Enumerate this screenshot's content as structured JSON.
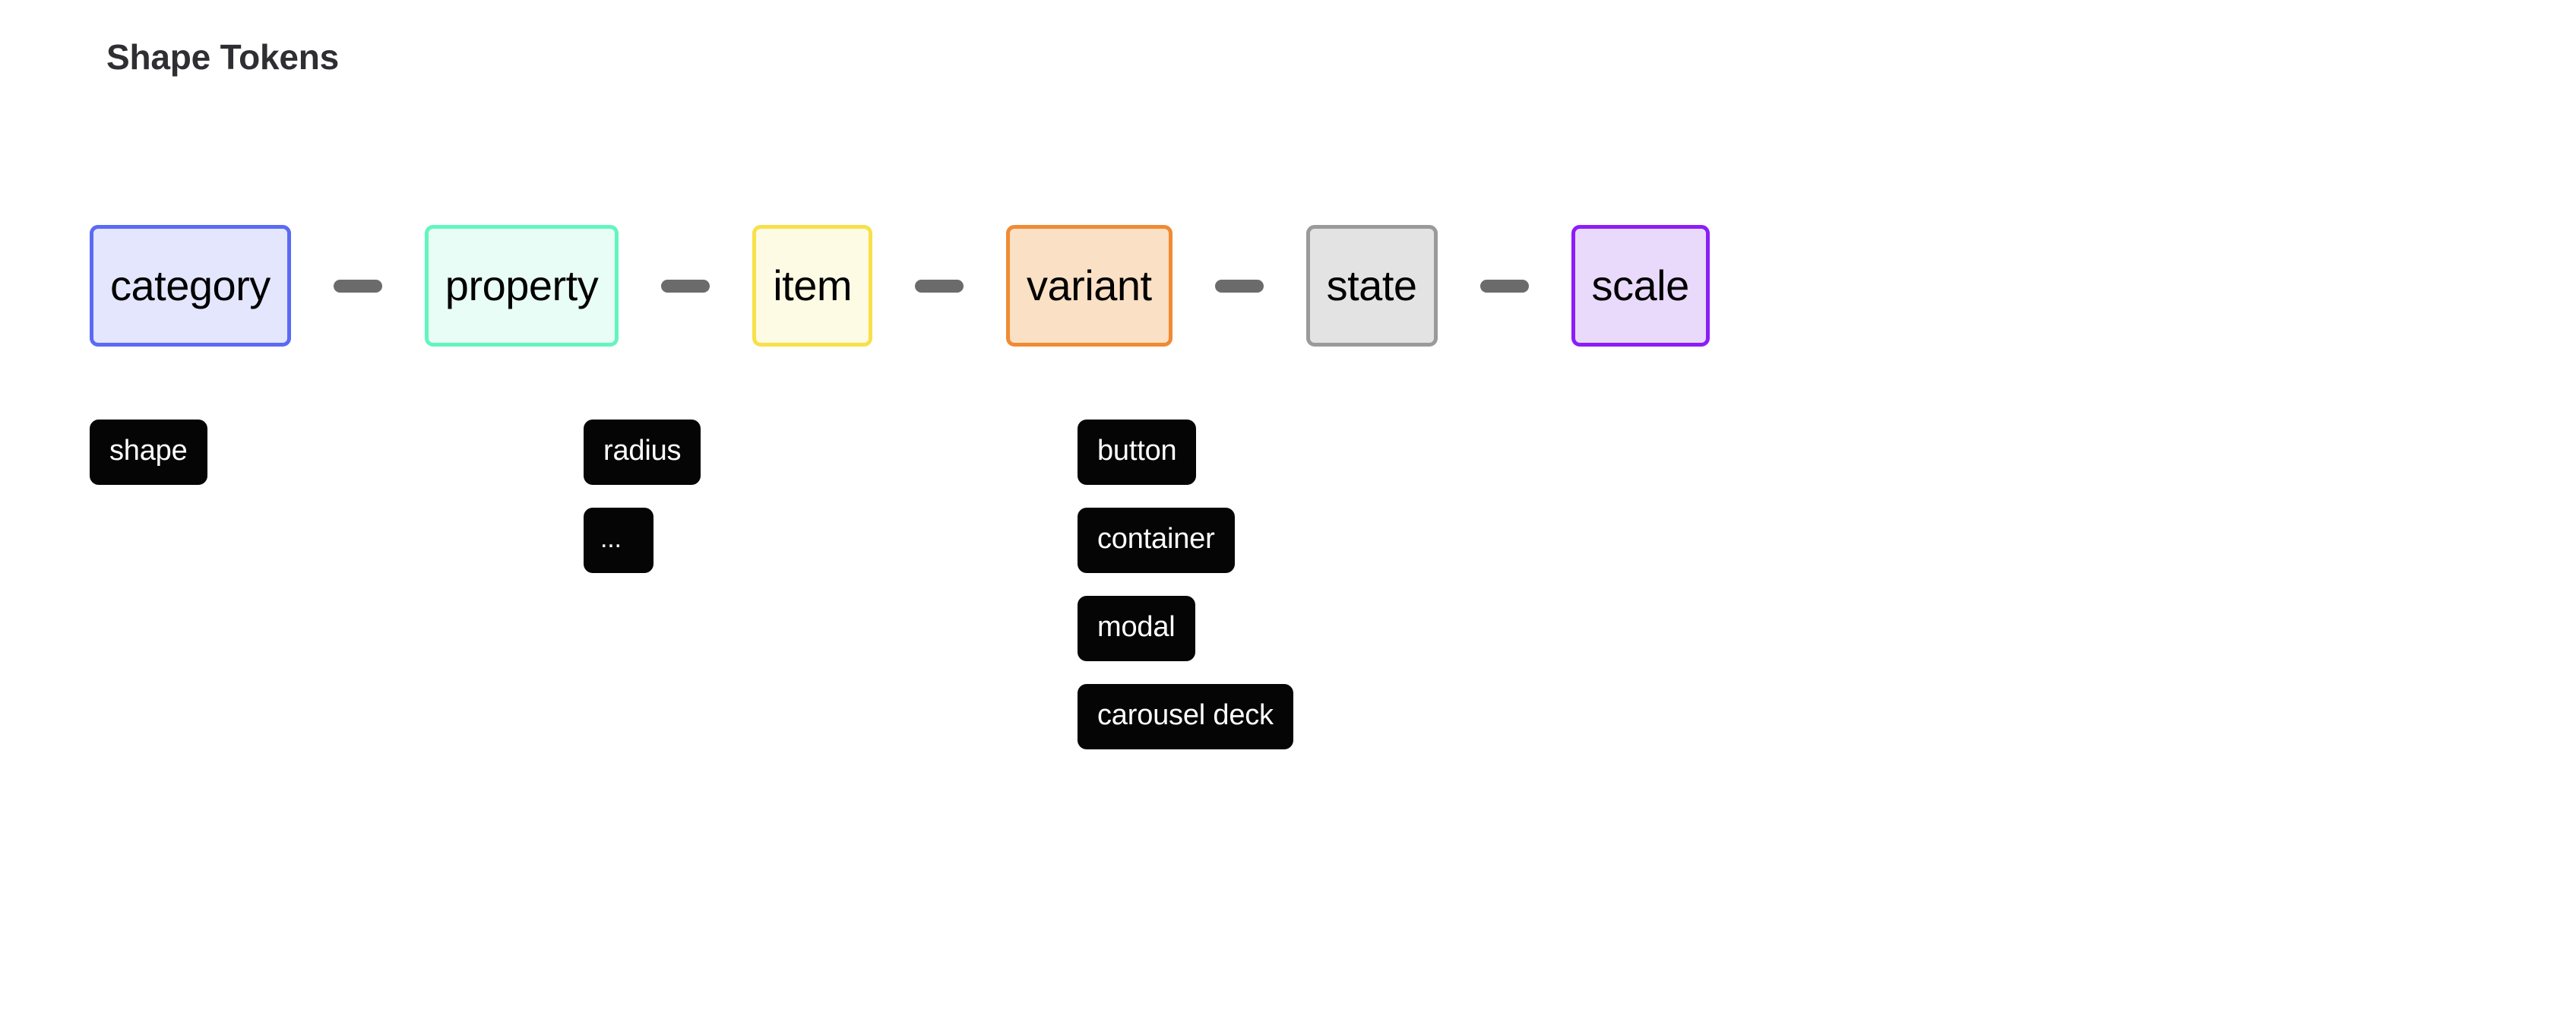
{
  "page": {
    "title": "Shape Tokens",
    "background_color": "#ffffff"
  },
  "schema": {
    "separator_glyph": "—",
    "separator_color": "#6b6b6b",
    "segments": [
      {
        "id": "category",
        "label": "category",
        "fill_color": "#e3e6fc",
        "border_color": "#5b6af5"
      },
      {
        "id": "property",
        "label": "property",
        "fill_color": "#e8fdf6",
        "border_color": "#63f5c0"
      },
      {
        "id": "item",
        "label": "item",
        "fill_color": "#fdfbe4",
        "border_color": "#f7e04a"
      },
      {
        "id": "variant",
        "label": "variant",
        "fill_color": "#fae0c4",
        "border_color": "#f08a34"
      },
      {
        "id": "state",
        "label": "state",
        "fill_color": "#e3e3e3",
        "border_color": "#9a9a9a"
      },
      {
        "id": "scale",
        "label": "scale",
        "fill_color": "#e9d9fb",
        "border_color": "#8b1ef7"
      }
    ]
  },
  "token_columns": [
    {
      "segment": "category",
      "tokens": [
        {
          "label": "shape"
        }
      ]
    },
    {
      "segment": "property",
      "tokens": [
        {
          "label": "radius"
        },
        {
          "label": "..."
        }
      ]
    },
    {
      "segment": "item",
      "tokens": [
        {
          "label": "button"
        },
        {
          "label": "container"
        },
        {
          "label": "modal"
        },
        {
          "label": "carousel deck"
        }
      ]
    }
  ],
  "token_style": {
    "fill_color": "#050505",
    "text_color": "#ffffff"
  }
}
